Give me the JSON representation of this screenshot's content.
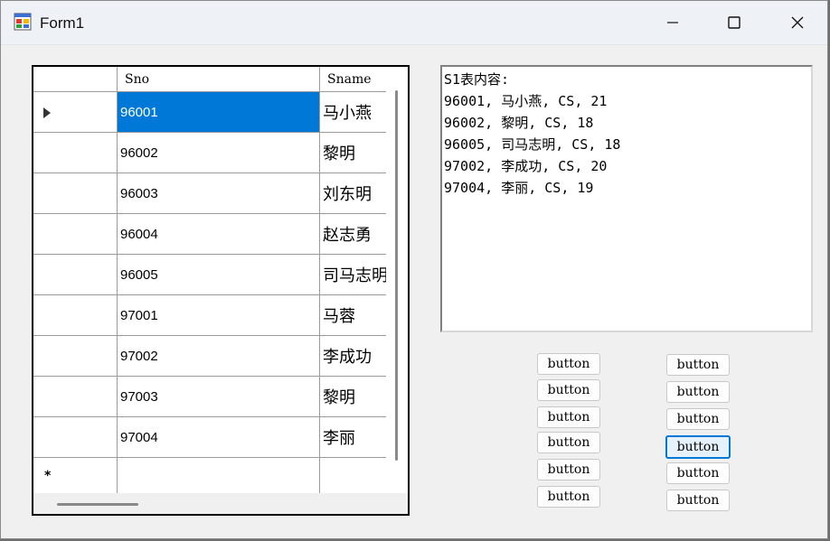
{
  "window": {
    "title": "Form1",
    "controls": [
      "minimize-icon",
      "maximize-icon",
      "close-icon"
    ]
  },
  "grid": {
    "columns": [
      "Sno",
      "Sname"
    ],
    "rows": [
      {
        "sno": "96001",
        "sname": "马小燕",
        "selected": true,
        "current": true
      },
      {
        "sno": "96002",
        "sname": "黎明"
      },
      {
        "sno": "96003",
        "sname": "刘东明"
      },
      {
        "sno": "96004",
        "sname": "赵志勇"
      },
      {
        "sno": "96005",
        "sname": "司马志明"
      },
      {
        "sno": "97001",
        "sname": "马蓉"
      },
      {
        "sno": "97002",
        "sname": "李成功"
      },
      {
        "sno": "97003",
        "sname": "黎明"
      },
      {
        "sno": "97004",
        "sname": "李丽"
      }
    ],
    "new_row_marker": "*",
    "current_row_icon": "arrow-right-icon"
  },
  "output": {
    "lines": [
      "S1表内容:",
      "96001, 马小燕, CS, 21",
      "96002, 黎明, CS, 18",
      "96005, 司马志明, CS, 18",
      "97002, 李成功, CS, 20",
      "97004, 李丽, CS, 19"
    ]
  },
  "buttons": {
    "left": [
      "button",
      "button",
      "button",
      "button",
      "button",
      "button"
    ],
    "right": [
      "button",
      "button",
      "button",
      "button",
      "button",
      "button"
    ],
    "focused_right_index": 3
  },
  "colors": {
    "selection": "#0078d7",
    "focus_border": "#0078d7"
  }
}
